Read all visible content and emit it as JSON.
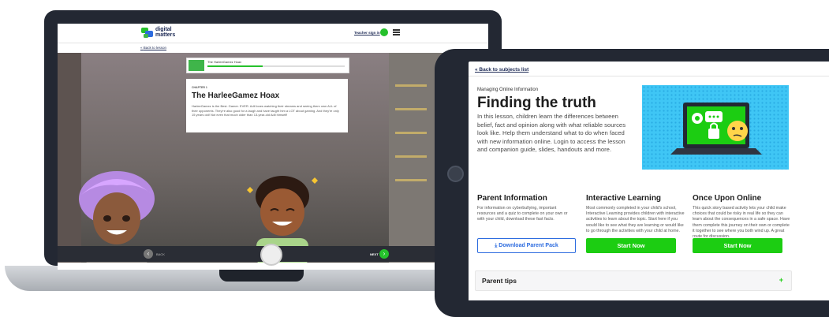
{
  "laptop": {
    "header": {
      "logo_line1": "digital",
      "logo_line2": "matters",
      "teacher_link": "Teacher sign in"
    },
    "back_link": "Back to lesson",
    "progress": {
      "title": "The HarleeGamez Hoax",
      "fraction": 0.4
    },
    "card": {
      "chapter": "CHAPTER 1",
      "title": "The HarleeGamez Hoax",
      "body": "HarleeGamez is the Best. Gamer. EVER. Adil loves watching their streams and seeing them own ALL of their opponents. They're also good for a laugh and have taught him a LOT about gaming. And they're only 15 years old! Not even that much older than 13-year-old Adil himself!"
    },
    "footer": {
      "back_label": "BACK",
      "next_label": "NEXT"
    }
  },
  "tablet": {
    "back_link": "Back to subjects list",
    "crumb": "Managing Online Information",
    "title": "Finding the truth",
    "description": "In this lesson, children learn the differences between belief, fact and opinion along with what reliable sources look like. Help them understand what to do when faced with new information online. Login to access the lesson and companion guide, slides, handouts and more.",
    "columns": [
      {
        "heading": "Parent Information",
        "body": "For information on cyberbullying, important resources and a quiz to complete on your own or with your child, download these fast facts.",
        "button": "Download Parent Pack"
      },
      {
        "heading": "Interactive Learning",
        "body": "Most commonly completed in your child's school, Interactive Learning provides children with interactive activities to learn about the topic. Start here if you would like to see what they are learning or would like to go through the activities with your child at home.",
        "button": "Start Now"
      },
      {
        "heading": "Once Upon Online",
        "body": "This quick story based activity lets your child make choices that could be risky in real life so they can learn about the consequences in a safe space. Have them complete this journey on their own or complete it together to see where you both wind up. A great route for discussion.",
        "button": "Start Now"
      }
    ],
    "tips": {
      "label": "Parent tips",
      "toggle": "+"
    }
  },
  "colors": {
    "accent_green": "#1ccd12",
    "link_blue": "#2d6cdf",
    "device_frame": "#232833"
  }
}
